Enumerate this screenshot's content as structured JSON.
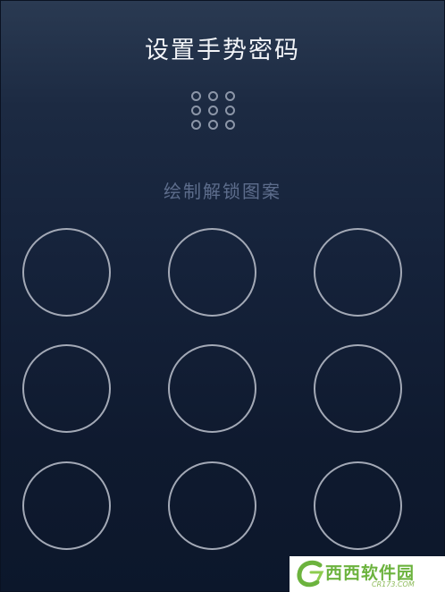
{
  "header": {
    "title": "设置手势密码"
  },
  "pattern_preview": {
    "dots": 9,
    "icon": "pattern-preview-icon"
  },
  "hint": {
    "text": "绘制解锁图案"
  },
  "pattern_grid": {
    "nodes": [
      "1",
      "2",
      "3",
      "4",
      "5",
      "6",
      "7",
      "8",
      "9"
    ]
  },
  "watermark": {
    "brand": "西西软件园",
    "url": "CR173.COM"
  },
  "colors": {
    "background_top": "#2a3a52",
    "background_bottom": "#0c172b",
    "node_ring": "#a3a9b6",
    "hint_text": "#5d6d8c",
    "title_text": "#f2f4f8",
    "watermark_green": "#6cb33e"
  }
}
